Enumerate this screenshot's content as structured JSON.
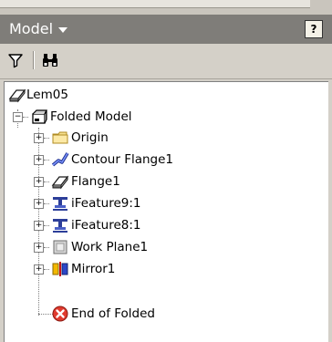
{
  "header": {
    "title": "Model",
    "help_label": "?"
  },
  "toolbar": {
    "filter_icon": "filter-icon",
    "find_icon": "binoculars-icon"
  },
  "tree": {
    "root": {
      "label": "Lem05",
      "icon": "flange-part-icon"
    },
    "assembly": {
      "label": "Folded Model",
      "icon": "folded-model-icon",
      "expanded": true
    },
    "items": [
      {
        "label": "Origin",
        "icon": "folder-icon"
      },
      {
        "label": "Contour Flange1",
        "icon": "contour-flange-icon"
      },
      {
        "label": "Flange1",
        "icon": "flange-icon"
      },
      {
        "label": "iFeature9:1",
        "icon": "ifeature-icon"
      },
      {
        "label": "iFeature8:1",
        "icon": "ifeature-icon"
      },
      {
        "label": "Work Plane1",
        "icon": "work-plane-icon"
      },
      {
        "label": "Mirror1",
        "icon": "mirror-icon"
      },
      {
        "label": "End of Folded",
        "icon": "end-of-part-icon"
      }
    ]
  }
}
